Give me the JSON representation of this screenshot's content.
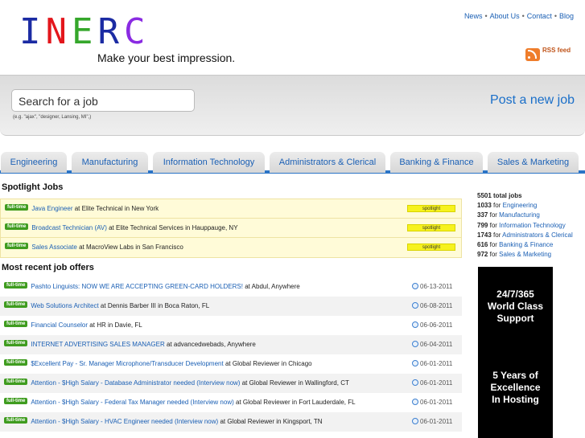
{
  "header": {
    "logo_letters": [
      {
        "char": "I",
        "color": "#1b2ba3"
      },
      {
        "char": "N",
        "color": "#e3161c"
      },
      {
        "char": "E",
        "color": "#35a72b"
      },
      {
        "char": "R",
        "color": "#1b2ba3"
      },
      {
        "char": "C",
        "color": "#8a2be2"
      }
    ],
    "tagline": "Make your best impression.",
    "nav": [
      "News",
      "About Us",
      "Contact",
      "Blog"
    ],
    "nav_separator": "•",
    "rss_label": "RSS feed"
  },
  "search": {
    "placeholder": "Search for a job",
    "hint": "(e.g. \"ajax\", \"designer, Lansing, MI\",)",
    "post_job": "Post a new job"
  },
  "tabs": [
    "Engineering",
    "Manufacturing",
    "Information Technology",
    "Administrators & Clerical",
    "Banking & Finance",
    "Sales & Marketing"
  ],
  "spotlight": {
    "title": "Spotlight Jobs",
    "badge": "spotlight",
    "jobs": [
      {
        "type": "full-time",
        "title": "Java Engineer",
        "at": "at",
        "company": "Elite Technical",
        "in": "in",
        "location": "New York"
      },
      {
        "type": "full-time",
        "title": "Broadcast Technician (AV)",
        "at": "at",
        "company": "Elite Technical Services",
        "in": "in",
        "location": "Hauppauge, NY"
      },
      {
        "type": "full-time",
        "title": "Sales Associate",
        "at": "at",
        "company": "MacroView Labs",
        "in": "in",
        "location": "San Francisco"
      }
    ]
  },
  "recent": {
    "title": "Most recent job offers",
    "jobs": [
      {
        "type": "full-time",
        "title": "Pashto Linguists: NOW WE ARE ACCEPTING GREEN-CARD HOLDERS!",
        "at": "at",
        "company": "Abdul",
        "sep": ",",
        "location": "Anywhere",
        "date": "06-13-2011"
      },
      {
        "type": "full-time",
        "title": "Web Solutions Architect",
        "at": "at",
        "company": "Dennis Barber III",
        "sep": "in",
        "location": "Boca Raton, FL",
        "date": "06-08-2011"
      },
      {
        "type": "full-time",
        "title": "Financial Counselor",
        "at": "at",
        "company": "HR",
        "sep": "in",
        "location": "Davie, FL",
        "date": "06-06-2011"
      },
      {
        "type": "full-time",
        "title": "INTERNET ADVERTISING SALES MANAGER",
        "at": "at",
        "company": "advancedwebads",
        "sep": ",",
        "location": "Anywhere",
        "date": "06-04-2011"
      },
      {
        "type": "full-time",
        "title": "$Excellent Pay - Sr. Manager Microphone/Transducer Development",
        "at": "at",
        "company": "Global Reviewer",
        "sep": "in",
        "location": "Chicago",
        "date": "06-01-2011"
      },
      {
        "type": "full-time",
        "title": "Attention - $High Salary - Database Administrator needed (Interview now)",
        "at": "at",
        "company": "Global Reviewer",
        "sep": "in",
        "location": "Wallingford, CT",
        "date": "06-01-2011"
      },
      {
        "type": "full-time",
        "title": "Attention - $High Salary - Federal Tax Manager needed (Interview now)",
        "at": "at",
        "company": "Global Reviewer",
        "sep": "in",
        "location": "Fort Lauderdale, FL",
        "date": "06-01-2011"
      },
      {
        "type": "full-time",
        "title": "Attention - $High Salary - HVAC Engineer needed (Interview now)",
        "at": "at",
        "company": "Global Reviewer",
        "sep": "in",
        "location": "Kingsport, TN",
        "date": "06-01-2011"
      }
    ]
  },
  "stats": {
    "total": "5501 total jobs",
    "for": "for",
    "items": [
      {
        "count": "1033",
        "label": "Engineering"
      },
      {
        "count": "337",
        "label": "Manufacturing"
      },
      {
        "count": "799",
        "label": "Information Technology"
      },
      {
        "count": "1743",
        "label": "Administrators & Clerical"
      },
      {
        "count": "616",
        "label": "Banking & Finance"
      },
      {
        "count": "972",
        "label": "Sales & Marketing"
      }
    ]
  },
  "ad": {
    "line1": "24/7/365",
    "line2": "World Class",
    "line3": "Support",
    "line4": "5 Years of",
    "line5": "Excellence",
    "line6": "In Hosting"
  },
  "colors": {
    "accent": "#2b74c6",
    "link": "#1a5fb4",
    "fulltime_badge": "#3f9c1f",
    "spotlight_badge": "#f6f21e"
  }
}
